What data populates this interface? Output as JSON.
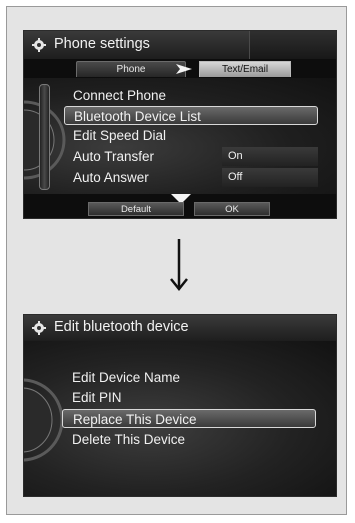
{
  "screen1": {
    "title": "Phone settings",
    "title_icon": "gear-icon",
    "tabs": [
      "Phone",
      "Text/Email"
    ],
    "items": [
      {
        "label": "Connect Phone",
        "value": ""
      },
      {
        "label": "Bluetooth Device List",
        "value": ""
      },
      {
        "label": "Edit Speed Dial",
        "value": ""
      },
      {
        "label": "Auto Transfer",
        "value": "On"
      },
      {
        "label": "Auto Answer",
        "value": "Off"
      }
    ],
    "selected_index": 1,
    "buttons": {
      "default": "Default",
      "ok": "OK"
    }
  },
  "screen2": {
    "title": "Edit bluetooth device",
    "title_icon": "gear-icon",
    "items": [
      "Edit Device Name",
      "Edit PIN",
      "Replace This Device",
      "Delete This Device"
    ],
    "selected_index": 2
  },
  "colors": {
    "screen_bg": "#141414",
    "text": "#f1f1f1",
    "frame_bg": "#e4e4e4"
  }
}
